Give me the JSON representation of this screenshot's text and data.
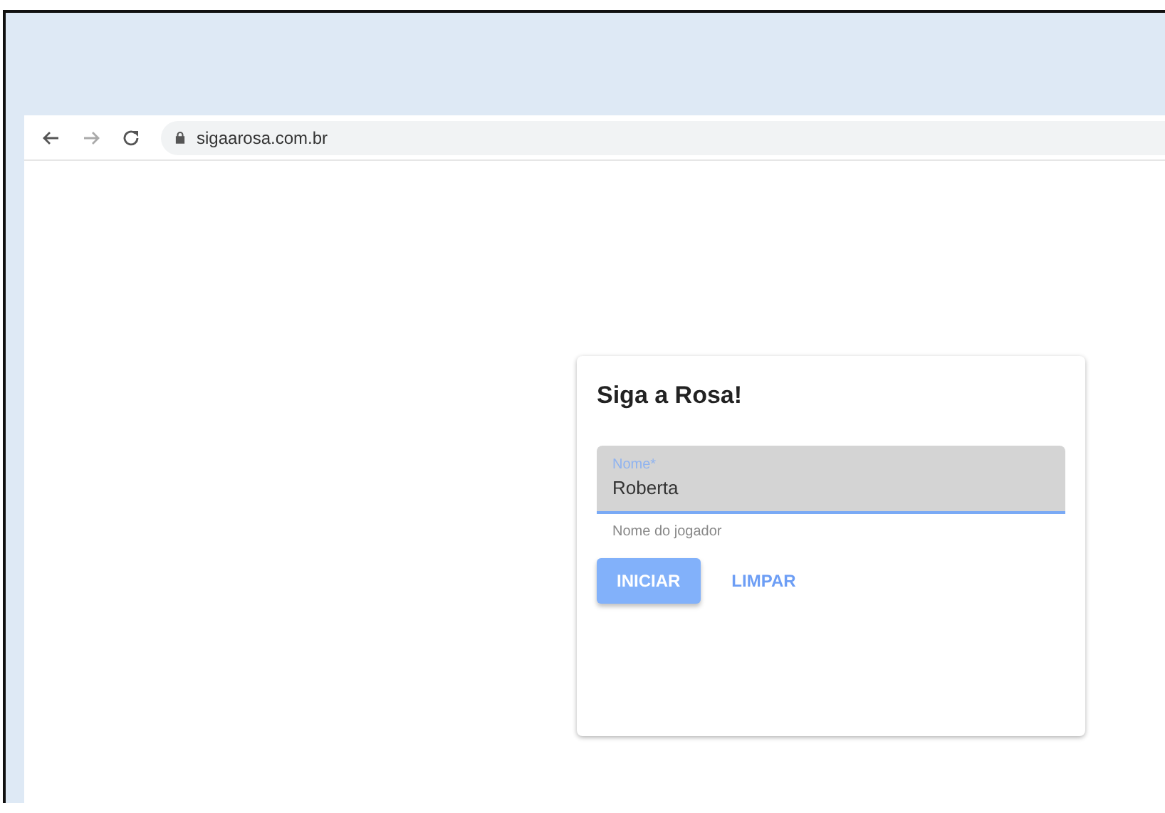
{
  "browser": {
    "url": "sigaarosa.com.br"
  },
  "card": {
    "title": "Siga a Rosa!",
    "field": {
      "label": "Nome*",
      "value": "Roberta",
      "hint": "Nome do jogador",
      "focused": true
    },
    "buttons": [
      {
        "label": "INICIAR",
        "kind": "raised"
      },
      {
        "label": "LIMPAR",
        "kind": "flat"
      }
    ]
  }
}
